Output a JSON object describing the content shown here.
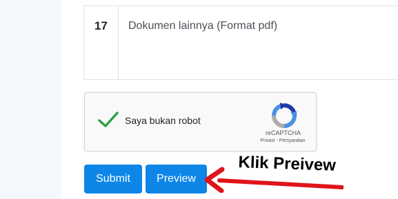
{
  "document_row": {
    "number": "17",
    "label": "Dokumen lainnya (Format pdf)"
  },
  "captcha": {
    "label": "Saya bukan robot",
    "brand": "reCAPTCHA",
    "privacy_link": "Privasi",
    "separator": " - ",
    "terms_link": "Persyaratan",
    "check_icon": "check-icon",
    "logo_icon": "recaptcha-logo-icon"
  },
  "buttons": {
    "submit_label": "Submit",
    "preview_label": "Preview"
  },
  "annotation": {
    "text": "Klik Preivew",
    "arrow_icon": "red-arrow-icon",
    "arrow_color": "#e0141b"
  },
  "colors": {
    "button": "#0d86e8",
    "check": "#2e9e48"
  }
}
